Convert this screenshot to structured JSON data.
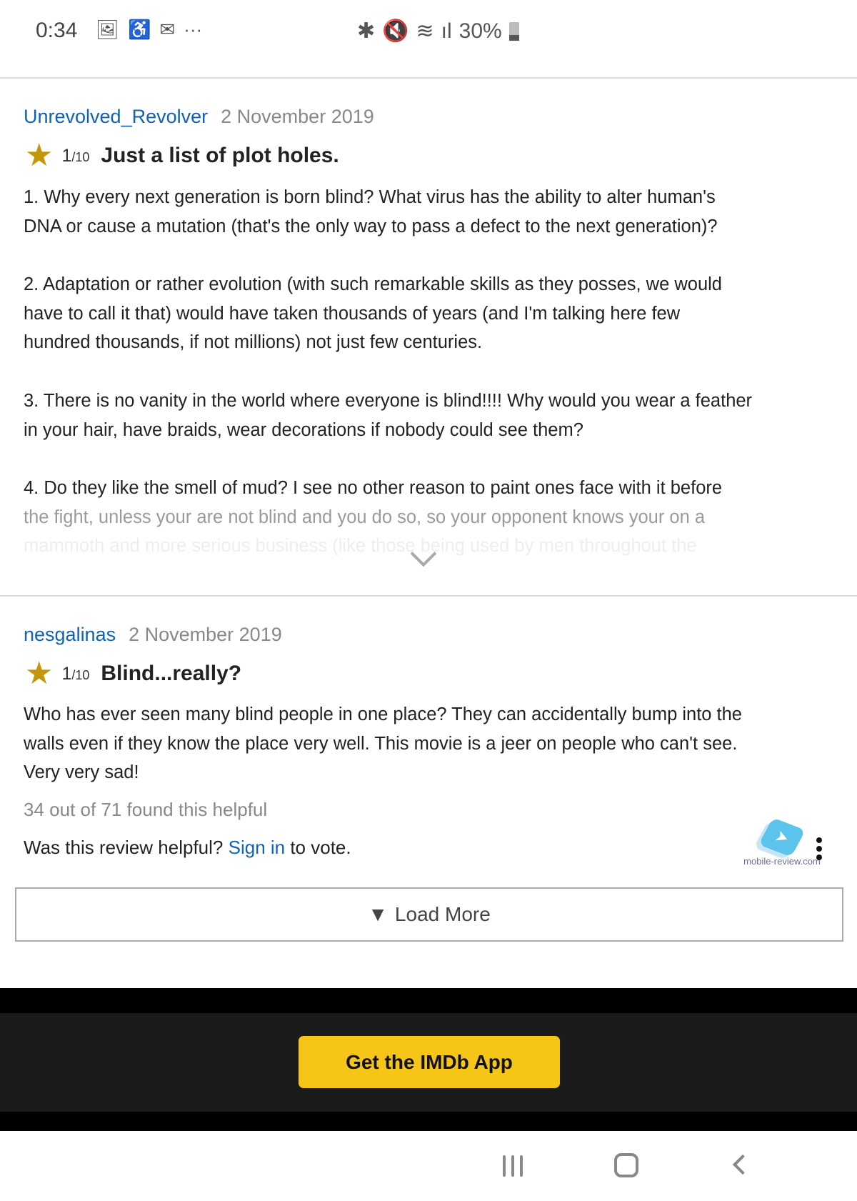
{
  "status_bar": {
    "time": "0:34",
    "battery": "30%",
    "left_icons": [
      "gallery-icon",
      "accessibility-icon",
      "gmail-icon",
      "more-dots-icon"
    ],
    "right_icons": [
      "bluetooth-icon",
      "mute-icon",
      "wifi-icon",
      "signal-icon",
      "battery-icon"
    ]
  },
  "reviews": [
    {
      "author": "Unrevolved_Revolver",
      "date": "2 November 2019",
      "rating": "1",
      "rating_max": "/10",
      "title": "Just a list of plot holes.",
      "lines": [
        "1. Why every next generation is born blind? What virus has the ability to alter human's",
        "DNA or cause a mutation (that's the only way to pass a defect to the next generation)?",
        "",
        "2. Adaptation or rather evolution (with such remarkable skills as they posses, we would",
        "have to call it that) would have taken thousands of years (and I'm talking here few",
        "hundred thousands, if not millions) not just few centuries.",
        "",
        "3. There is no vanity in the world where everyone is blind!!!! Why would you wear a feather",
        "in your hair, have braids, wear decorations if nobody could see them?",
        "",
        "4. Do they like the smell of mud? I see no other reason to paint ones face with it before"
      ],
      "fade_line": "the fight, unless your are not blind and you do so, so your opponent knows your on a",
      "faint_line": "mammoth and more serious business (like those being used by men throughout the"
    },
    {
      "author": "nesgalinas",
      "date": "2 November 2019",
      "rating": "1",
      "rating_max": "/10",
      "title": "Blind...really?",
      "lines": [
        "Who has ever seen many blind people in one place? They can accidentally bump into the",
        "walls even if they know the place very well. This movie is a jeer on people who can't see.",
        "Very very sad!"
      ],
      "helpful": "34 out of 71 found this helpful",
      "vote_prefix": "Was this review helpful? ",
      "vote_link": "Sign in",
      "vote_suffix": " to vote."
    }
  ],
  "watermark": "mobile-review.com",
  "load_more": "Load More",
  "app_button": "Get the IMDb App",
  "colors": {
    "link": "#0f63b5",
    "star": "#c5960a",
    "imdb_yellow": "#f5c518"
  }
}
